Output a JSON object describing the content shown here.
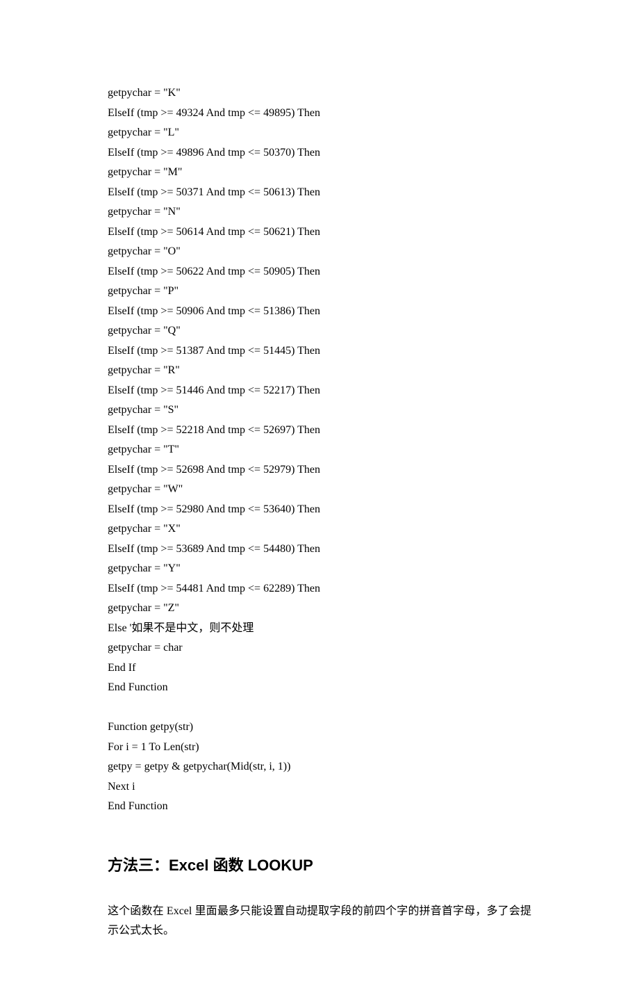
{
  "code_lines": [
    "getpychar = \"K\"",
    "ElseIf (tmp >= 49324 And tmp <= 49895) Then",
    "getpychar = \"L\"",
    "ElseIf (tmp >= 49896 And tmp <= 50370) Then",
    "getpychar = \"M\"",
    "ElseIf (tmp >= 50371 And tmp <= 50613) Then",
    "getpychar = \"N\"",
    "ElseIf (tmp >= 50614 And tmp <= 50621) Then",
    "getpychar = \"O\"",
    "ElseIf (tmp >= 50622 And tmp <= 50905) Then",
    "getpychar = \"P\"",
    "ElseIf (tmp >= 50906 And tmp <= 51386) Then",
    "getpychar = \"Q\"",
    "ElseIf (tmp >= 51387 And tmp <= 51445) Then",
    "getpychar = \"R\"",
    "ElseIf (tmp >= 51446 And tmp <= 52217) Then",
    "getpychar = \"S\"",
    "ElseIf (tmp >= 52218 And tmp <= 52697) Then",
    "getpychar = \"T\"",
    "ElseIf (tmp >= 52698 And tmp <= 52979) Then",
    "getpychar = \"W\"",
    "ElseIf (tmp >= 52980 And tmp <= 53640) Then",
    "getpychar = \"X\"",
    "ElseIf (tmp >= 53689 And tmp <= 54480) Then",
    "getpychar = \"Y\"",
    "ElseIf (tmp >= 54481 And tmp <= 62289) Then",
    "getpychar = \"Z\"",
    "Else '如果不是中文，则不处理",
    "getpychar = char",
    "End If",
    "End Function",
    "",
    "Function getpy(str)",
    "For i = 1 To Len(str)",
    "getpy = getpy & getpychar(Mid(str, i, 1))",
    "Next i",
    "End Function"
  ],
  "heading": "方法三：Excel 函数 LOOKUP",
  "paragraph": "这个函数在 Excel 里面最多只能设置自动提取字段的前四个字的拼音首字母，多了会提示公式太长。"
}
